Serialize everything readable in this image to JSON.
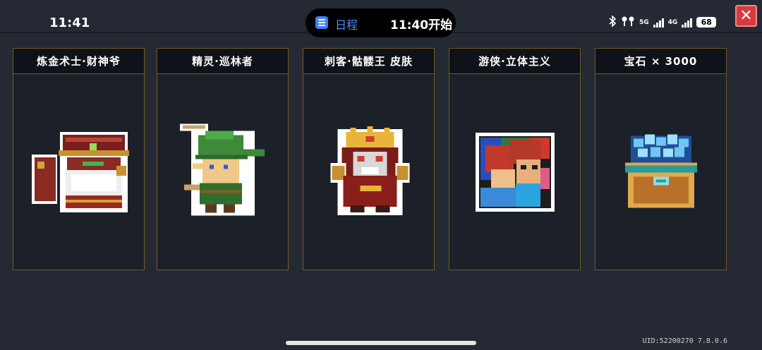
{
  "status_bar": {
    "time": "11:41",
    "island": {
      "label": "日程",
      "time": "11:40开始"
    },
    "network_5g": "5G",
    "network_4g": "4G",
    "battery": "68"
  },
  "close_button": {
    "label": "✕"
  },
  "rewards": [
    {
      "title": "炼金术士·财神爷",
      "icon": "alchemist-god-of-wealth-icon"
    },
    {
      "title": "精灵·巡林者",
      "icon": "elf-ranger-icon"
    },
    {
      "title": "刺客·骷髅王 皮肤",
      "icon": "assassin-skeleton-king-icon"
    },
    {
      "title": "游侠·立体主义",
      "icon": "ranger-cubism-icon"
    },
    {
      "title": "宝石 × 3000",
      "icon": "gem-chest-icon"
    }
  ],
  "footer": {
    "uid": "UID:52200270 7.8.0.6"
  },
  "colors": {
    "background": "#252933",
    "card_border": "#6e5a22",
    "close_red": "#d43c3c",
    "island_blue": "#4a8cff"
  }
}
